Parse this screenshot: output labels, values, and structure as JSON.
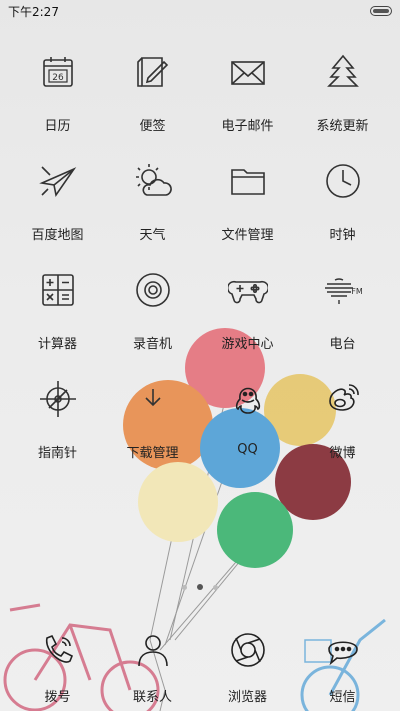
{
  "status": {
    "time": "下午2:27"
  },
  "apps": [
    {
      "name": "calendar-icon",
      "label": "日历",
      "badge": "26"
    },
    {
      "name": "note-icon",
      "label": "便签"
    },
    {
      "name": "mail-icon",
      "label": "电子邮件"
    },
    {
      "name": "update-icon",
      "label": "系统更新"
    },
    {
      "name": "map-icon",
      "label": "百度地图"
    },
    {
      "name": "weather-icon",
      "label": "天气"
    },
    {
      "name": "folder-icon",
      "label": "文件管理"
    },
    {
      "name": "clock-icon",
      "label": "时钟"
    },
    {
      "name": "calculator-icon",
      "label": "计算器"
    },
    {
      "name": "recorder-icon",
      "label": "录音机"
    },
    {
      "name": "gamepad-icon",
      "label": "游戏中心"
    },
    {
      "name": "radio-icon",
      "label": "电台",
      "badge": "FM"
    },
    {
      "name": "compass-icon",
      "label": "指南针"
    },
    {
      "name": "download-icon",
      "label": "下载管理"
    },
    {
      "name": "qq-icon",
      "label": "QQ"
    },
    {
      "name": "weibo-icon",
      "label": "微博"
    }
  ],
  "page_indicator": {
    "count": 3,
    "active": 2
  },
  "dock": [
    {
      "name": "phone-icon",
      "label": "拨号"
    },
    {
      "name": "contacts-icon",
      "label": "联系人"
    },
    {
      "name": "browser-icon",
      "label": "浏览器"
    },
    {
      "name": "sms-icon",
      "label": "短信"
    }
  ]
}
